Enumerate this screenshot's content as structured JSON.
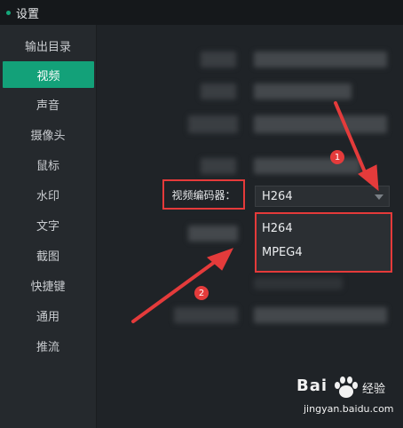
{
  "window": {
    "title": "设置"
  },
  "sidebar": {
    "items": [
      {
        "label": "输出目录",
        "active": false
      },
      {
        "label": "视频",
        "active": true
      },
      {
        "label": "声音",
        "active": false
      },
      {
        "label": "摄像头",
        "active": false
      },
      {
        "label": "鼠标",
        "active": false
      },
      {
        "label": "水印",
        "active": false
      },
      {
        "label": "文字",
        "active": false
      },
      {
        "label": "截图",
        "active": false
      },
      {
        "label": "快捷键",
        "active": false
      },
      {
        "label": "通用",
        "active": false
      },
      {
        "label": "推流",
        "active": false
      }
    ]
  },
  "video_encoder": {
    "label": "视频编码器：",
    "selected": "H264",
    "options": [
      "H264",
      "MPEG4"
    ]
  },
  "annotations": {
    "step1": "1",
    "step2": "2"
  },
  "watermark": {
    "brand": "Bai",
    "cn": "经验",
    "url": "jingyan.baidu.com"
  },
  "colors": {
    "accent": "#13a179",
    "highlight": "#e53a3a",
    "background": "#1f2327",
    "sidebar": "#25292d"
  },
  "icons": [
    "caret-down-icon",
    "baidu-paw-icon"
  ]
}
